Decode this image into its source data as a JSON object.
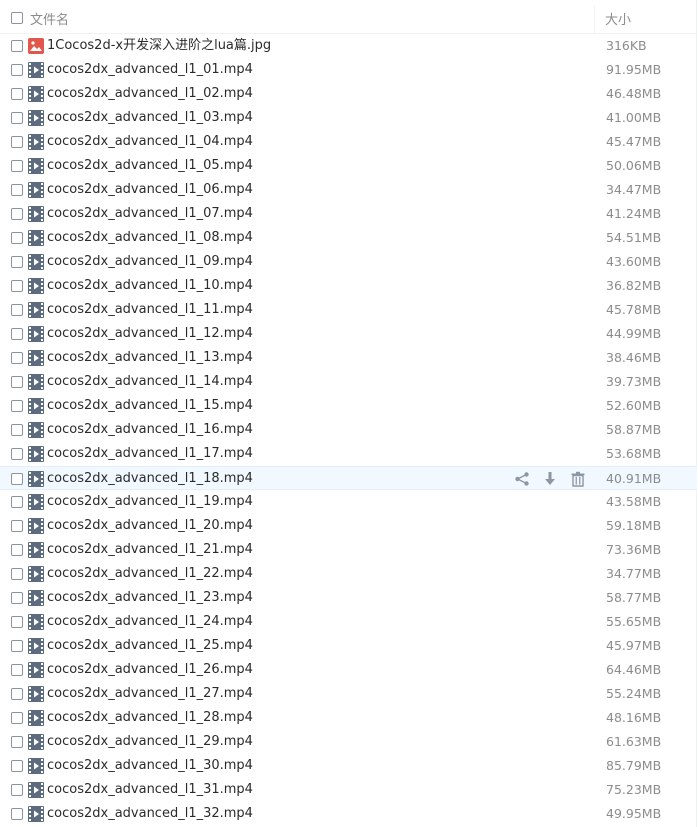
{
  "header": {
    "name_label": "文件名",
    "size_label": "大小"
  },
  "files": [
    {
      "name": "1Cocos2d-x开发深入进阶之lua篇.jpg",
      "size": "316KB",
      "type": "image"
    },
    {
      "name": "cocos2dx_advanced_l1_01.mp4",
      "size": "91.95MB",
      "type": "video"
    },
    {
      "name": "cocos2dx_advanced_l1_02.mp4",
      "size": "46.48MB",
      "type": "video"
    },
    {
      "name": "cocos2dx_advanced_l1_03.mp4",
      "size": "41.00MB",
      "type": "video"
    },
    {
      "name": "cocos2dx_advanced_l1_04.mp4",
      "size": "45.47MB",
      "type": "video"
    },
    {
      "name": "cocos2dx_advanced_l1_05.mp4",
      "size": "50.06MB",
      "type": "video"
    },
    {
      "name": "cocos2dx_advanced_l1_06.mp4",
      "size": "34.47MB",
      "type": "video"
    },
    {
      "name": "cocos2dx_advanced_l1_07.mp4",
      "size": "41.24MB",
      "type": "video"
    },
    {
      "name": "cocos2dx_advanced_l1_08.mp4",
      "size": "54.51MB",
      "type": "video"
    },
    {
      "name": "cocos2dx_advanced_l1_09.mp4",
      "size": "43.60MB",
      "type": "video"
    },
    {
      "name": "cocos2dx_advanced_l1_10.mp4",
      "size": "36.82MB",
      "type": "video"
    },
    {
      "name": "cocos2dx_advanced_l1_11.mp4",
      "size": "45.78MB",
      "type": "video"
    },
    {
      "name": "cocos2dx_advanced_l1_12.mp4",
      "size": "44.99MB",
      "type": "video"
    },
    {
      "name": "cocos2dx_advanced_l1_13.mp4",
      "size": "38.46MB",
      "type": "video"
    },
    {
      "name": "cocos2dx_advanced_l1_14.mp4",
      "size": "39.73MB",
      "type": "video"
    },
    {
      "name": "cocos2dx_advanced_l1_15.mp4",
      "size": "52.60MB",
      "type": "video"
    },
    {
      "name": "cocos2dx_advanced_l1_16.mp4",
      "size": "58.87MB",
      "type": "video"
    },
    {
      "name": "cocos2dx_advanced_l1_17.mp4",
      "size": "53.68MB",
      "type": "video"
    },
    {
      "name": "cocos2dx_advanced_l1_18.mp4",
      "size": "40.91MB",
      "type": "video",
      "hovered": true
    },
    {
      "name": "cocos2dx_advanced_l1_19.mp4",
      "size": "43.58MB",
      "type": "video"
    },
    {
      "name": "cocos2dx_advanced_l1_20.mp4",
      "size": "59.18MB",
      "type": "video"
    },
    {
      "name": "cocos2dx_advanced_l1_21.mp4",
      "size": "73.36MB",
      "type": "video"
    },
    {
      "name": "cocos2dx_advanced_l1_22.mp4",
      "size": "34.77MB",
      "type": "video"
    },
    {
      "name": "cocos2dx_advanced_l1_23.mp4",
      "size": "58.77MB",
      "type": "video"
    },
    {
      "name": "cocos2dx_advanced_l1_24.mp4",
      "size": "55.65MB",
      "type": "video"
    },
    {
      "name": "cocos2dx_advanced_l1_25.mp4",
      "size": "45.97MB",
      "type": "video"
    },
    {
      "name": "cocos2dx_advanced_l1_26.mp4",
      "size": "64.46MB",
      "type": "video"
    },
    {
      "name": "cocos2dx_advanced_l1_27.mp4",
      "size": "55.24MB",
      "type": "video"
    },
    {
      "name": "cocos2dx_advanced_l1_28.mp4",
      "size": "48.16MB",
      "type": "video"
    },
    {
      "name": "cocos2dx_advanced_l1_29.mp4",
      "size": "61.63MB",
      "type": "video"
    },
    {
      "name": "cocos2dx_advanced_l1_30.mp4",
      "size": "85.79MB",
      "type": "video"
    },
    {
      "name": "cocos2dx_advanced_l1_31.mp4",
      "size": "75.23MB",
      "type": "video"
    },
    {
      "name": "cocos2dx_advanced_l1_32.mp4",
      "size": "49.95MB",
      "type": "video"
    }
  ],
  "hover_actions": [
    "share-icon",
    "download-icon",
    "delete-icon"
  ],
  "colors": {
    "hover_bg": "#f1f8ff",
    "size_text": "#8c8c8c",
    "icon_gray": "#8d97a4",
    "image_icon": "#e2574c",
    "video_icon": "#5d6b7e"
  }
}
